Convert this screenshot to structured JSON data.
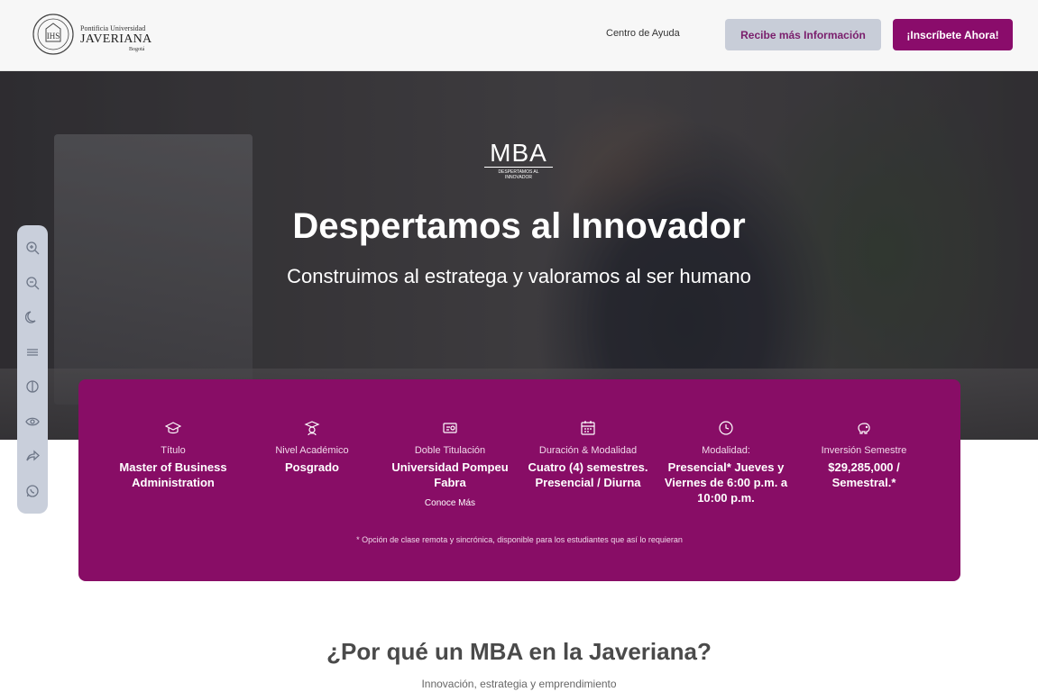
{
  "header": {
    "logo": {
      "line1": "Pontificia Universidad",
      "line2": "JAVERIANA",
      "line3": "Bogotá"
    },
    "help_link": "Centro de Ayuda",
    "info_button": "Recibe más Información",
    "apply_button": "¡Inscríbete Ahora!",
    "colors": {
      "primary": "#8a0c6b",
      "secondary": "#c8cdd8"
    }
  },
  "hero": {
    "logo_big": "MBA",
    "logo_small": "DESPERTAMOS AL INNOVADOR",
    "title": "Despertamos al Innovador",
    "subtitle": "Construimos al estratega y valoramos al ser humano"
  },
  "toolbar": {
    "buttons": [
      "zoom-in-icon",
      "zoom-out-icon",
      "dark-mode-icon",
      "text-spacing-icon",
      "contrast-icon",
      "eye-icon",
      "share-icon",
      "whatsapp-icon"
    ]
  },
  "card": {
    "items": [
      {
        "icon": "graduation-cap-icon",
        "label": "Título",
        "value": "Master of Business Administration"
      },
      {
        "icon": "academic-level-icon",
        "label": "Nivel Académico",
        "value": "Posgrado"
      },
      {
        "icon": "double-degree-icon",
        "label": "Doble Titulación",
        "value": "Universidad Pompeu Fabra",
        "link": "Conoce Más"
      },
      {
        "icon": "calendar-icon",
        "label": "Duración & Modalidad",
        "value": "Cuatro (4) semestres. Presencial / Diurna"
      },
      {
        "icon": "clock-icon",
        "label": "Modalidad:",
        "value": "Presencial* Jueves y Viernes de 6:00 p.m. a 10:00 p.m."
      },
      {
        "icon": "piggy-bank-icon",
        "label": "Inversión Semestre",
        "value": "$29,285,000 / Semestral.*"
      }
    ],
    "note": "* Opción de clase remota y sincrónica, disponible para los estudiantes que así lo requieran"
  },
  "section": {
    "title": "¿Por qué un MBA en la Javeriana?",
    "subtitle": "Innovación, estrategia y emprendimiento"
  }
}
